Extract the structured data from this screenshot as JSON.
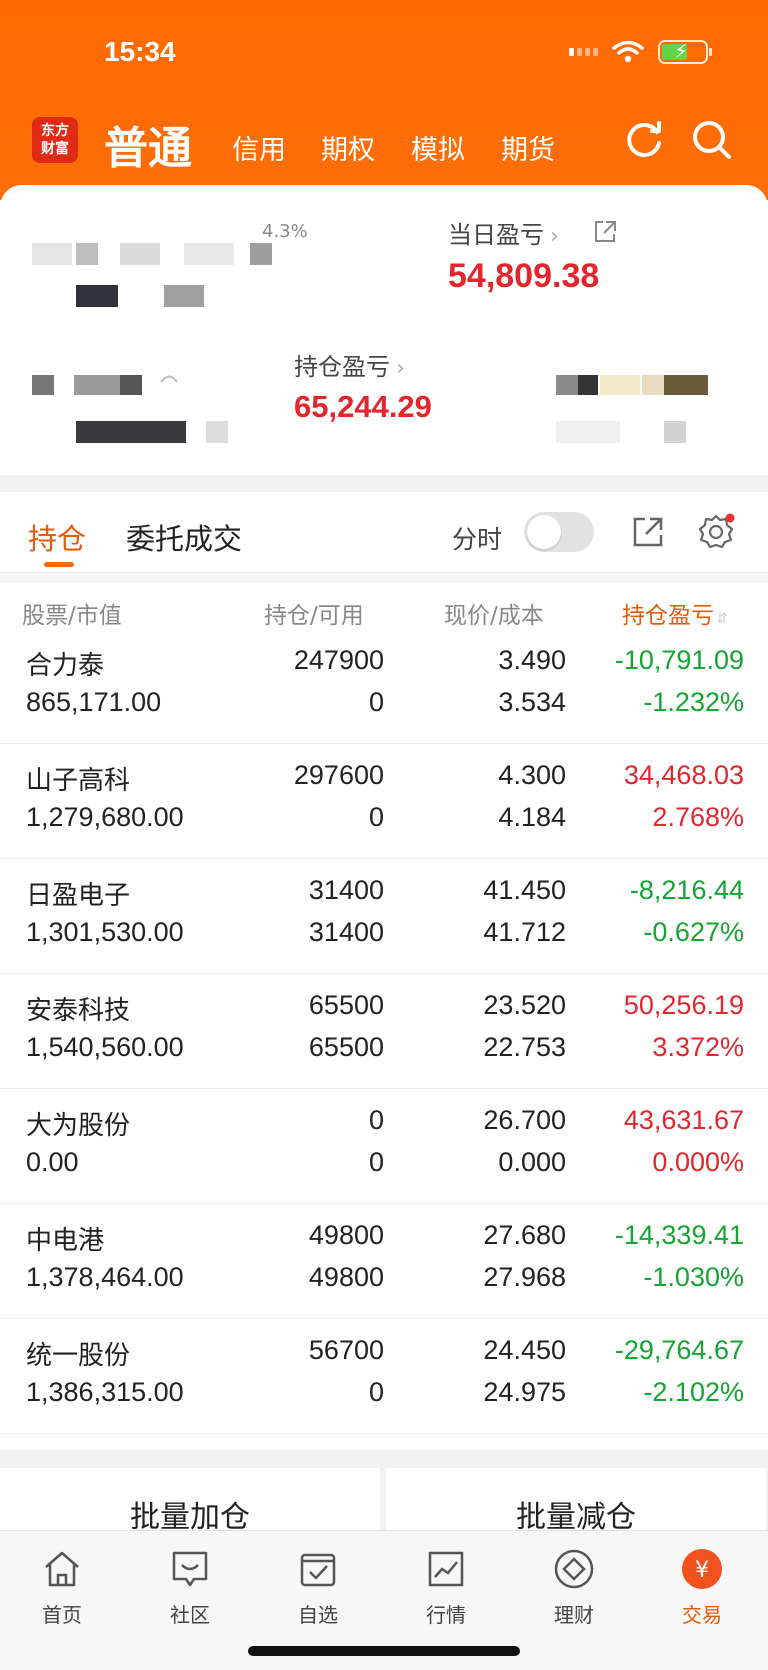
{
  "status_bar": {
    "time": "15:34"
  },
  "logo": {
    "text_line1": "东方",
    "text_line2": "财富"
  },
  "header_tabs": {
    "active": "普通",
    "items": [
      "信用",
      "期权",
      "模拟",
      "期货"
    ]
  },
  "summary": {
    "masked_percent": "4.3%",
    "daily_pl_label": "当日盈亏",
    "daily_pl_value": "54,809.38",
    "position_pl_label": "持仓盈亏",
    "position_pl_value": "65,244.29"
  },
  "position_tabs": {
    "holdings": "持仓",
    "orders": "委托成交",
    "intraday_label": "分时"
  },
  "columns": {
    "stock": "股票",
    "market_value": "市值",
    "holding": "持仓",
    "available": "可用",
    "price": "现价",
    "cost": "成本",
    "pl": "持仓盈亏"
  },
  "holdings": [
    {
      "name": "合力泰",
      "market_value": "865,171.00",
      "holding": "247900",
      "available": "0",
      "price": "3.490",
      "cost": "3.534",
      "pl": "-10,791.09",
      "pl_pct": "-1.232%"
    },
    {
      "name": "山子高科",
      "market_value": "1,279,680.00",
      "holding": "297600",
      "available": "0",
      "price": "4.300",
      "cost": "4.184",
      "pl": "34,468.03",
      "pl_pct": "2.768%"
    },
    {
      "name": "日盈电子",
      "market_value": "1,301,530.00",
      "holding": "31400",
      "available": "31400",
      "price": "41.450",
      "cost": "41.712",
      "pl": "-8,216.44",
      "pl_pct": "-0.627%"
    },
    {
      "name": "安泰科技",
      "market_value": "1,540,560.00",
      "holding": "65500",
      "available": "65500",
      "price": "23.520",
      "cost": "22.753",
      "pl": "50,256.19",
      "pl_pct": "3.372%"
    },
    {
      "name": "大为股份",
      "market_value": "0.00",
      "holding": "0",
      "available": "0",
      "price": "26.700",
      "cost": "0.000",
      "pl": "43,631.67",
      "pl_pct": "0.000%"
    },
    {
      "name": "中电港",
      "market_value": "1,378,464.00",
      "holding": "49800",
      "available": "49800",
      "price": "27.680",
      "cost": "27.968",
      "pl": "-14,339.41",
      "pl_pct": "-1.030%"
    },
    {
      "name": "统一股份",
      "market_value": "1,386,315.00",
      "holding": "56700",
      "available": "0",
      "price": "24.450",
      "cost": "24.975",
      "pl": "-29,764.67",
      "pl_pct": "-2.102%"
    }
  ],
  "batch": {
    "add": "批量加仓",
    "reduce": "批量减仓"
  },
  "tabbar": {
    "home": "首页",
    "community": "社区",
    "watchlist": "自选",
    "market": "行情",
    "wealth": "理财",
    "trade": "交易"
  },
  "colors": {
    "brand": "#ff6a00",
    "up": "#e3262e",
    "down": "#14a532"
  }
}
